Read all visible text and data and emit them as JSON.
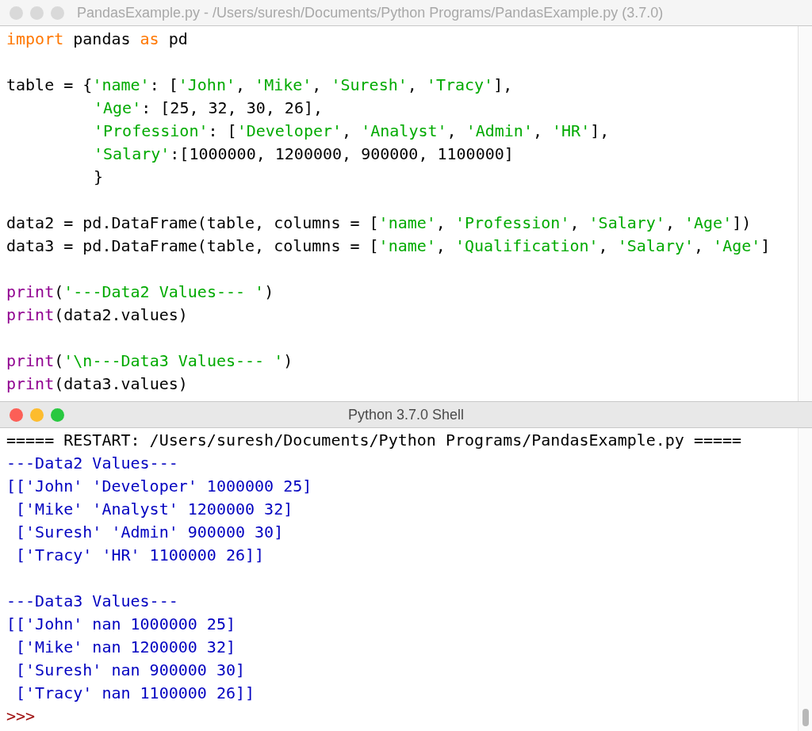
{
  "editor": {
    "title": "PandasExample.py - /Users/suresh/Documents/Python Programs/PandasExample.py (3.7.0)",
    "active": false,
    "lines": [
      {
        "kind": "code",
        "tokens": [
          {
            "kind": "keyword",
            "text": "import"
          },
          {
            "kind": "plain",
            "text": " pandas "
          },
          {
            "kind": "keyword",
            "text": "as"
          },
          {
            "kind": "plain",
            "text": " pd"
          }
        ]
      },
      {
        "kind": "blank"
      },
      {
        "kind": "code",
        "tokens": [
          {
            "kind": "plain",
            "text": "table = {"
          },
          {
            "kind": "string",
            "text": "'name'"
          },
          {
            "kind": "plain",
            "text": ": ["
          },
          {
            "kind": "string",
            "text": "'John'"
          },
          {
            "kind": "plain",
            "text": ", "
          },
          {
            "kind": "string",
            "text": "'Mike'"
          },
          {
            "kind": "plain",
            "text": ", "
          },
          {
            "kind": "string",
            "text": "'Suresh'"
          },
          {
            "kind": "plain",
            "text": ", "
          },
          {
            "kind": "string",
            "text": "'Tracy'"
          },
          {
            "kind": "plain",
            "text": "],"
          }
        ]
      },
      {
        "kind": "code",
        "indented": true,
        "tokens": [
          {
            "kind": "string",
            "text": "'Age'"
          },
          {
            "kind": "plain",
            "text": ": [25, 32, 30, 26],"
          }
        ]
      },
      {
        "kind": "code",
        "indented": true,
        "tokens": [
          {
            "kind": "string",
            "text": "'Profession'"
          },
          {
            "kind": "plain",
            "text": ": ["
          },
          {
            "kind": "string",
            "text": "'Developer'"
          },
          {
            "kind": "plain",
            "text": ", "
          },
          {
            "kind": "string",
            "text": "'Analyst'"
          },
          {
            "kind": "plain",
            "text": ", "
          },
          {
            "kind": "string",
            "text": "'Admin'"
          },
          {
            "kind": "plain",
            "text": ", "
          },
          {
            "kind": "string",
            "text": "'HR'"
          },
          {
            "kind": "plain",
            "text": "],"
          }
        ]
      },
      {
        "kind": "code",
        "indented": true,
        "tokens": [
          {
            "kind": "string",
            "text": "'Salary'"
          },
          {
            "kind": "plain",
            "text": ":[1000000, 1200000, 900000, 1100000]"
          }
        ]
      },
      {
        "kind": "code",
        "indented": true,
        "tokens": [
          {
            "kind": "plain",
            "text": "}"
          }
        ]
      },
      {
        "kind": "blank"
      },
      {
        "kind": "code",
        "tokens": [
          {
            "kind": "plain",
            "text": "data2 = pd.DataFrame(table, columns = ["
          },
          {
            "kind": "string",
            "text": "'name'"
          },
          {
            "kind": "plain",
            "text": ", "
          },
          {
            "kind": "string",
            "text": "'Profession'"
          },
          {
            "kind": "plain",
            "text": ", "
          },
          {
            "kind": "string",
            "text": "'Salary'"
          },
          {
            "kind": "plain",
            "text": ", "
          },
          {
            "kind": "string",
            "text": "'Age'"
          },
          {
            "kind": "plain",
            "text": "])"
          }
        ]
      },
      {
        "kind": "code",
        "tokens": [
          {
            "kind": "plain",
            "text": "data3 = pd.DataFrame(table, columns = ["
          },
          {
            "kind": "string",
            "text": "'name'"
          },
          {
            "kind": "plain",
            "text": ", "
          },
          {
            "kind": "string",
            "text": "'Qualification'"
          },
          {
            "kind": "plain",
            "text": ", "
          },
          {
            "kind": "string",
            "text": "'Salary'"
          },
          {
            "kind": "plain",
            "text": ", "
          },
          {
            "kind": "string",
            "text": "'Age'"
          },
          {
            "kind": "plain",
            "text": "]"
          }
        ]
      },
      {
        "kind": "blank"
      },
      {
        "kind": "code",
        "tokens": [
          {
            "kind": "builtin",
            "text": "print"
          },
          {
            "kind": "plain",
            "text": "("
          },
          {
            "kind": "string",
            "text": "'---Data2 Values--- '"
          },
          {
            "kind": "plain",
            "text": ")"
          }
        ]
      },
      {
        "kind": "code",
        "tokens": [
          {
            "kind": "builtin",
            "text": "print"
          },
          {
            "kind": "plain",
            "text": "(data2.values)"
          }
        ]
      },
      {
        "kind": "blank"
      },
      {
        "kind": "code",
        "tokens": [
          {
            "kind": "builtin",
            "text": "print"
          },
          {
            "kind": "plain",
            "text": "("
          },
          {
            "kind": "string",
            "text": "'\\n---Data3 Values--- '"
          },
          {
            "kind": "plain",
            "text": ")"
          }
        ]
      },
      {
        "kind": "code",
        "tokens": [
          {
            "kind": "builtin",
            "text": "print"
          },
          {
            "kind": "plain",
            "text": "(data3.values)"
          }
        ]
      }
    ]
  },
  "shell": {
    "title": "Python 3.7.0 Shell",
    "active": true,
    "lines": [
      {
        "kind": "restart",
        "text": "===== RESTART: /Users/suresh/Documents/Python Programs/PandasExample.py ====="
      },
      {
        "kind": "output",
        "text": "---Data2 Values---"
      },
      {
        "kind": "output",
        "text": "[['John' 'Developer' 1000000 25]"
      },
      {
        "kind": "output",
        "text": " ['Mike' 'Analyst' 1200000 32]"
      },
      {
        "kind": "output",
        "text": " ['Suresh' 'Admin' 900000 30]"
      },
      {
        "kind": "output",
        "text": " ['Tracy' 'HR' 1100000 26]]"
      },
      {
        "kind": "blank"
      },
      {
        "kind": "output",
        "text": "---Data3 Values---"
      },
      {
        "kind": "output",
        "text": "[['John' nan 1000000 25]"
      },
      {
        "kind": "output",
        "text": " ['Mike' nan 1200000 32]"
      },
      {
        "kind": "output",
        "text": " ['Suresh' nan 900000 30]"
      },
      {
        "kind": "output",
        "text": " ['Tracy' nan 1100000 26]]"
      },
      {
        "kind": "prompt",
        "text": ">>>"
      }
    ]
  }
}
